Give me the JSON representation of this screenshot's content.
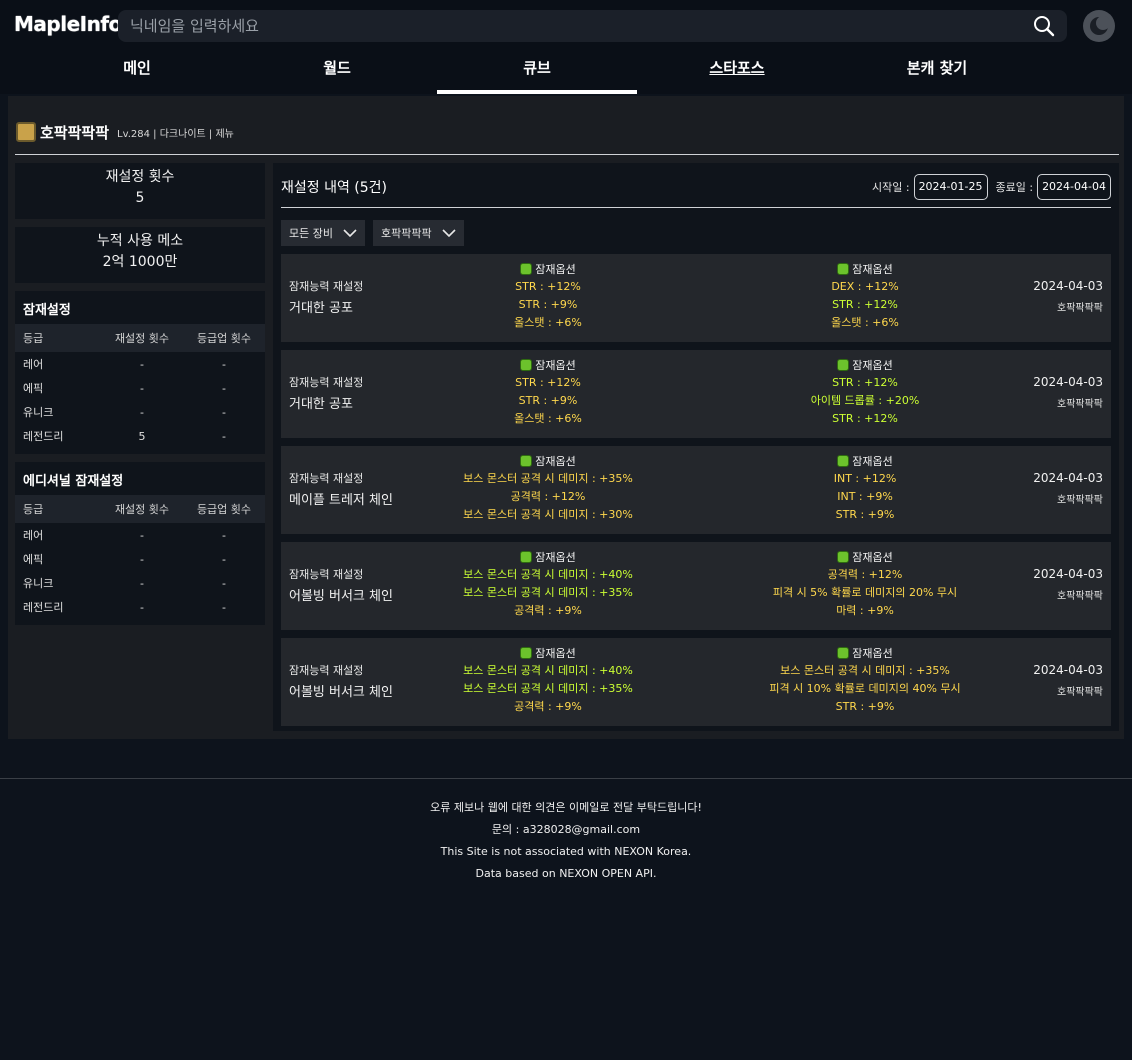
{
  "app": {
    "logo": "MapleInfo"
  },
  "search": {
    "placeholder": "닉네임을 입력하세요"
  },
  "nav": {
    "tabs": [
      "메인",
      "월드",
      "큐브",
      "스타포스",
      "본캐 찾기"
    ]
  },
  "character": {
    "name": "호팍팍팍팍",
    "meta": "Lv.284 | 다크나이트 | 제뉴"
  },
  "summary": {
    "reset_count_label": "재설정 횟수",
    "reset_count": "5",
    "meso_label": "누적 사용 메소",
    "meso_value": "2억 1000만"
  },
  "potential": {
    "title": "잠재설정",
    "headers": [
      "등급",
      "재설정 횟수",
      "등급업 횟수"
    ],
    "rows": [
      {
        "grade": "레어",
        "resets": "-",
        "ups": "-"
      },
      {
        "grade": "에픽",
        "resets": "-",
        "ups": "-"
      },
      {
        "grade": "유니크",
        "resets": "-",
        "ups": "-"
      },
      {
        "grade": "레전드리",
        "resets": "5",
        "ups": "-"
      }
    ]
  },
  "additional": {
    "title": "에디셔널 잠재설정",
    "headers": [
      "등급",
      "재설정 횟수",
      "등급업 횟수"
    ],
    "rows": [
      {
        "grade": "레어",
        "resets": "-",
        "ups": "-"
      },
      {
        "grade": "에픽",
        "resets": "-",
        "ups": "-"
      },
      {
        "grade": "유니크",
        "resets": "-",
        "ups": "-"
      },
      {
        "grade": "레전드리",
        "resets": "-",
        "ups": "-"
      }
    ]
  },
  "history": {
    "title": "재설정 내역 (5건)",
    "start_label": "시작일 :",
    "start_date": "2024-01-25",
    "end_label": "종료일 :",
    "end_date": "2024-04-04",
    "filter_equipment": "모든 장비",
    "filter_character": "호팍팍팍팍",
    "records": [
      {
        "type": "잠재능력 재설정",
        "item": "거대한 공포",
        "date": "2024-04-03",
        "character": "호팍팍팍팍",
        "before_label": "잠재옵션",
        "before": [
          {
            "text": "STR : +12%",
            "color": "yellow"
          },
          {
            "text": "STR : +9%",
            "color": "yellow"
          },
          {
            "text": "올스탯 : +6%",
            "color": "yellow"
          }
        ],
        "after_label": "잠재옵션",
        "after": [
          {
            "text": "DEX : +12%",
            "color": "yellow"
          },
          {
            "text": "STR : +12%",
            "color": "green"
          },
          {
            "text": "올스탯 : +6%",
            "color": "yellow"
          }
        ]
      },
      {
        "type": "잠재능력 재설정",
        "item": "거대한 공포",
        "date": "2024-04-03",
        "character": "호팍팍팍팍",
        "before_label": "잠재옵션",
        "before": [
          {
            "text": "STR : +12%",
            "color": "yellow"
          },
          {
            "text": "STR : +9%",
            "color": "yellow"
          },
          {
            "text": "올스탯 : +6%",
            "color": "yellow"
          }
        ],
        "after_label": "잠재옵션",
        "after": [
          {
            "text": "STR : +12%",
            "color": "green"
          },
          {
            "text": "아이템 드롭률 : +20%",
            "color": "green"
          },
          {
            "text": "STR : +12%",
            "color": "green"
          }
        ]
      },
      {
        "type": "잠재능력 재설정",
        "item": "메이플 트레저 체인",
        "date": "2024-04-03",
        "character": "호팍팍팍팍",
        "before_label": "잠재옵션",
        "before": [
          {
            "text": "보스 몬스터 공격 시 데미지 : +35%",
            "color": "yellow"
          },
          {
            "text": "공격력 : +12%",
            "color": "yellow"
          },
          {
            "text": "보스 몬스터 공격 시 데미지 : +30%",
            "color": "yellow"
          }
        ],
        "after_label": "잠재옵션",
        "after": [
          {
            "text": "INT : +12%",
            "color": "yellow"
          },
          {
            "text": "INT : +9%",
            "color": "yellow"
          },
          {
            "text": "STR : +9%",
            "color": "yellow"
          }
        ]
      },
      {
        "type": "잠재능력 재설정",
        "item": "어볼빙 버서크 체인",
        "date": "2024-04-03",
        "character": "호팍팍팍팍",
        "before_label": "잠재옵션",
        "before": [
          {
            "text": "보스 몬스터 공격 시 데미지 : +40%",
            "color": "green"
          },
          {
            "text": "보스 몬스터 공격 시 데미지 : +35%",
            "color": "green"
          },
          {
            "text": "공격력 : +9%",
            "color": "yellow"
          }
        ],
        "after_label": "잠재옵션",
        "after": [
          {
            "text": "공격력 : +12%",
            "color": "yellow"
          },
          {
            "text": "피격 시 5% 확률로 데미지의 20% 무시",
            "color": "yellow"
          },
          {
            "text": "마력 : +9%",
            "color": "yellow"
          }
        ]
      },
      {
        "type": "잠재능력 재설정",
        "item": "어볼빙 버서크 체인",
        "date": "2024-04-03",
        "character": "호팍팍팍팍",
        "before_label": "잠재옵션",
        "before": [
          {
            "text": "보스 몬스터 공격 시 데미지 : +40%",
            "color": "green"
          },
          {
            "text": "보스 몬스터 공격 시 데미지 : +35%",
            "color": "green"
          },
          {
            "text": "공격력 : +9%",
            "color": "yellow"
          }
        ],
        "after_label": "잠재옵션",
        "after": [
          {
            "text": "보스 몬스터 공격 시 데미지 : +35%",
            "color": "yellow"
          },
          {
            "text": "피격 시 10% 확률로 데미지의 40% 무시",
            "color": "yellow"
          },
          {
            "text": "STR : +9%",
            "color": "yellow"
          }
        ]
      }
    ]
  },
  "footer": {
    "lines": [
      "오류 제보나 웹에 대한 의견은 이메일로 전달 부탁드립니다!",
      "문의 : a328028@gmail.com",
      "This Site is not associated with NEXON Korea.",
      "Data based on NEXON OPEN API."
    ]
  }
}
